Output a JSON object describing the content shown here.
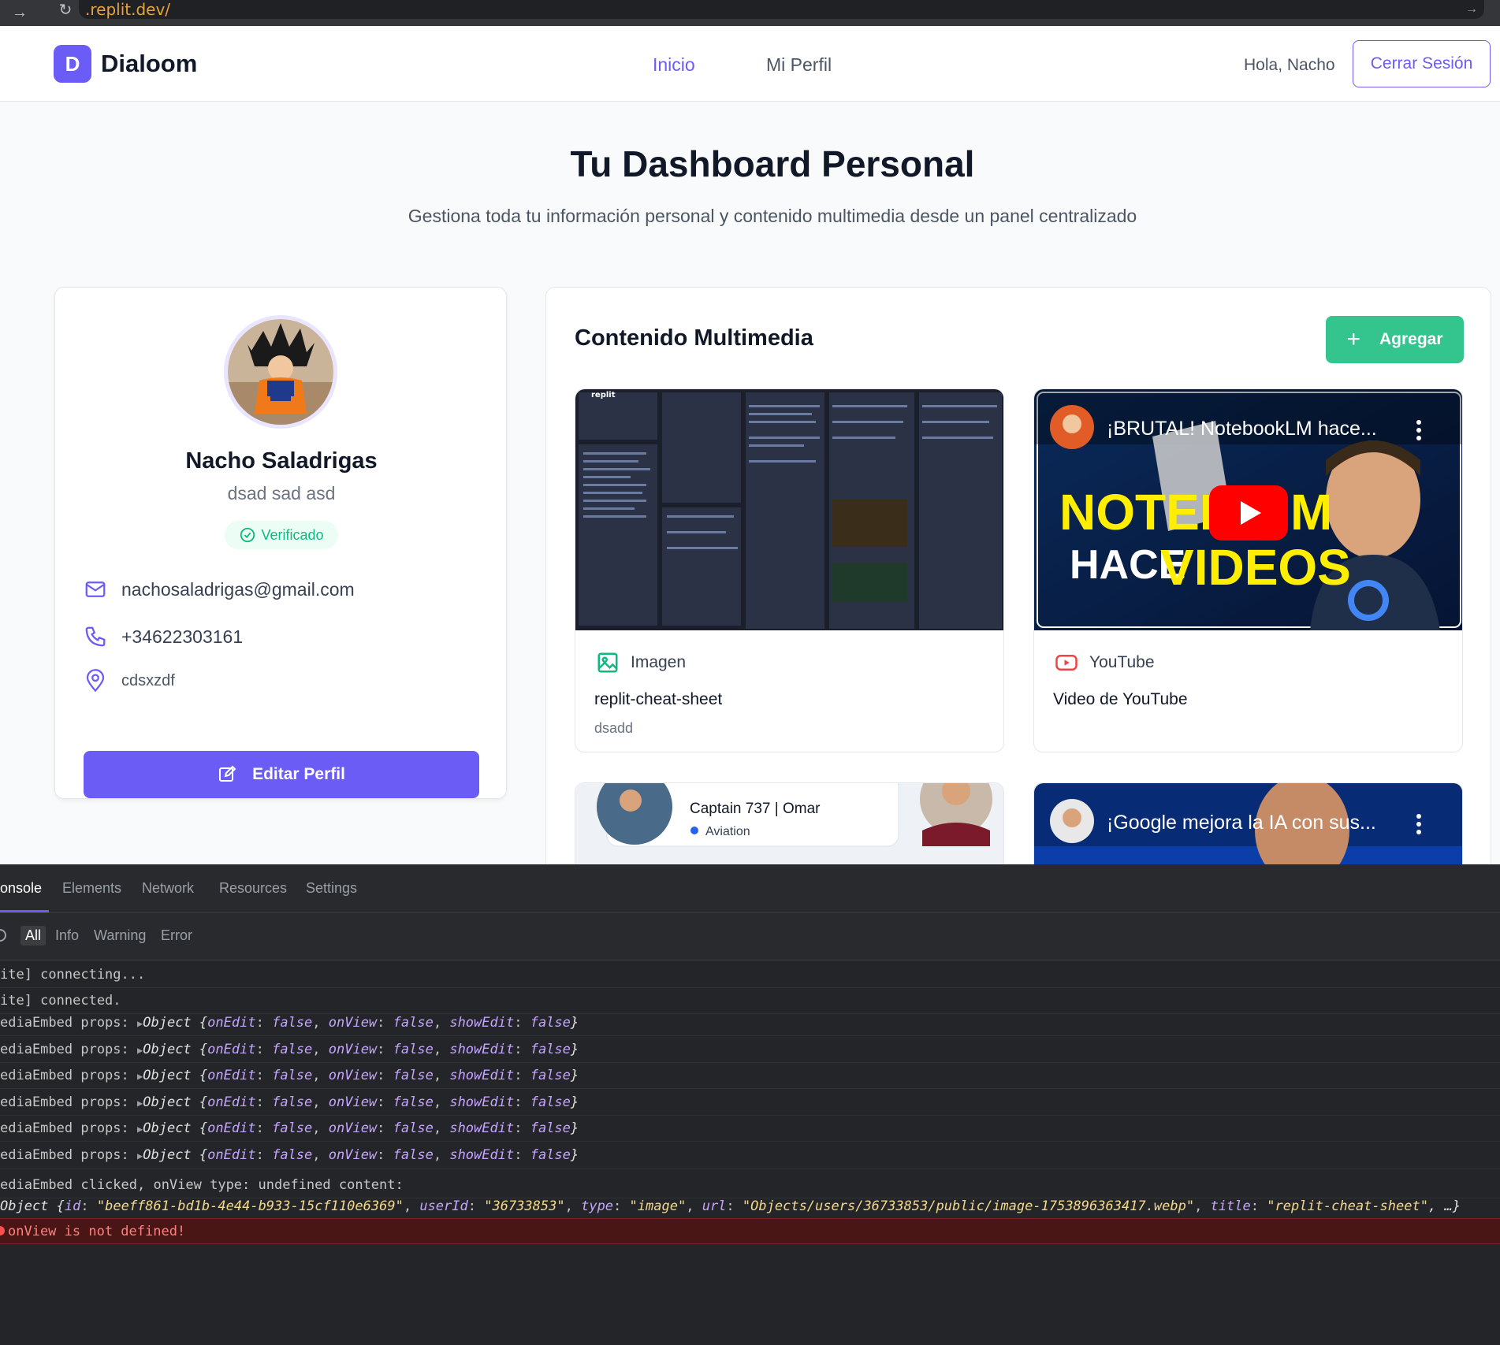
{
  "browser": {
    "url": ".replit.dev/"
  },
  "nav": {
    "logo_letter": "D",
    "brand": "Dialoom",
    "links": [
      "Inicio",
      "Mi Perfil"
    ],
    "greeting": "Hola, Nacho",
    "logout_label": "Cerrar Sesión"
  },
  "hero": {
    "title": "Tu Dashboard Personal",
    "subtitle": "Gestiona toda tu información personal y contenido multimedia desde un panel centralizado"
  },
  "profile": {
    "name": "Nacho Saladrigas",
    "bio": "dsad sad asd",
    "verified_label": "Verificado",
    "email": "nachosaladrigas@gmail.com",
    "phone": "+34622303161",
    "location": "cdsxzdf",
    "edit_label": "Editar Perfil"
  },
  "media": {
    "title": "Contenido Multimedia",
    "add_label": "Agregar",
    "items": [
      {
        "type_label": "Imagen",
        "title": "replit-cheat-sheet",
        "description": "dsadd",
        "thumb_brand": "replit"
      },
      {
        "type_label": "YouTube",
        "title": "Video de YouTube",
        "thumb_overlay_title": "¡BRUTAL! NotebookLM hace...",
        "thumb_big_text_1": "NOTEBO",
        "thumb_big_text_1b": "M",
        "thumb_big_text_2a": "HACE",
        "thumb_big_text_2b": "VIDEOS"
      },
      {
        "thumb_name": "Captain 737 | Omar",
        "thumb_sub": "Aviation"
      },
      {
        "thumb_overlay_title": "¡Google mejora la IA con sus..."
      }
    ]
  },
  "devtools": {
    "tabs": [
      "onsole",
      "Elements",
      "Network",
      "Resources",
      "Settings"
    ],
    "filters": [
      "All",
      "Info",
      "Warning",
      "Error"
    ],
    "logs": [
      "ite] connecting...",
      "ite] connected."
    ],
    "props_prefix": "ediaEmbed props:",
    "props_obj": "Object",
    "props_count": 6,
    "clicked_line": "ediaEmbed clicked, onView type: undefined content:",
    "object_line": {
      "id": "beeff861-bd1b-4e44-b933-15cf110e6369",
      "userId": "36733853",
      "type": "image",
      "url": "Objects/users/36733853/public/image-1753896363417.webp",
      "title": "replit-cheat-sheet"
    },
    "error_text": "onView is not defined!"
  },
  "colors": {
    "primary": "#6b5cf6",
    "success": "#34c58f",
    "youtube_red": "#ff0000"
  }
}
